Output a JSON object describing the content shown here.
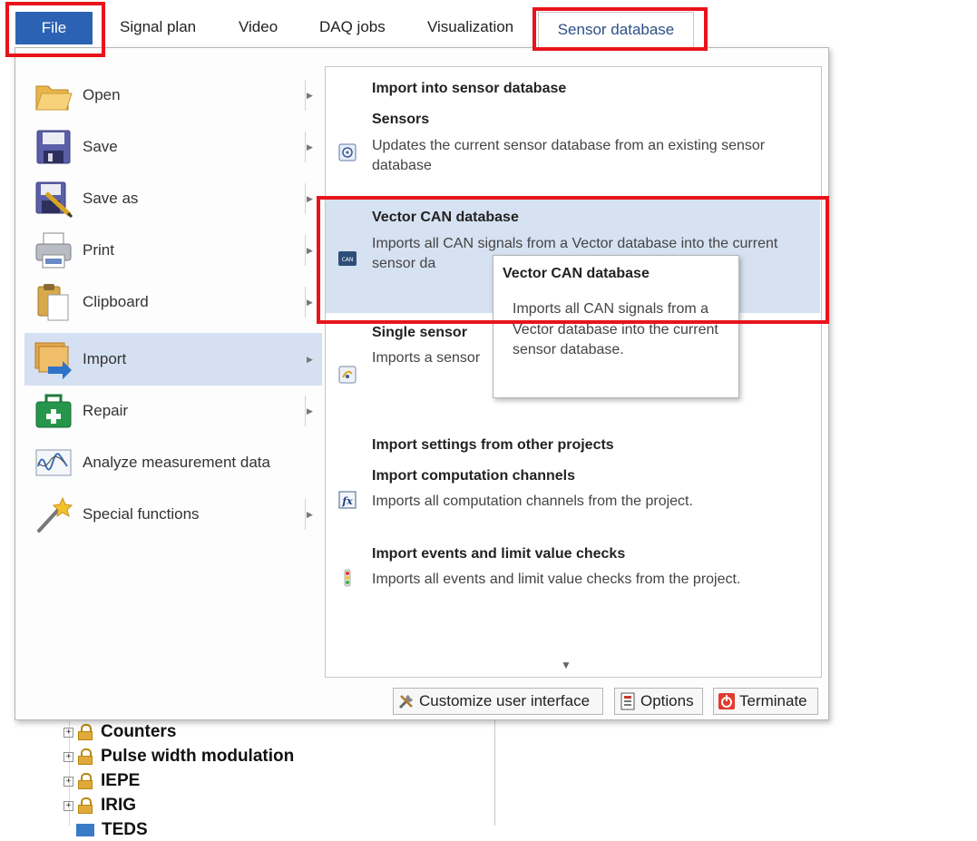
{
  "ribbon": {
    "file_tab": "File",
    "tabs": [
      {
        "label": "Signal plan"
      },
      {
        "label": "Video"
      },
      {
        "label": "DAQ jobs"
      },
      {
        "label": "Visualization"
      },
      {
        "label": "Sensor database"
      }
    ],
    "selected_tab": "Sensor database"
  },
  "file_menu": {
    "items": [
      {
        "label": "Open",
        "icon": "folder-open-icon",
        "submenu": true
      },
      {
        "label": "Save",
        "icon": "floppy-disk-icon",
        "submenu": true
      },
      {
        "label": "Save as",
        "icon": "save-as-icon",
        "submenu": true
      },
      {
        "label": "Print",
        "icon": "printer-icon",
        "submenu": true
      },
      {
        "label": "Clipboard",
        "icon": "clipboard-icon",
        "submenu": true
      },
      {
        "label": "Import",
        "icon": "import-icon",
        "submenu": true,
        "active": true
      },
      {
        "label": "Repair",
        "icon": "first-aid-kit-icon",
        "submenu": true
      },
      {
        "label": "Analyze measurement data",
        "icon": "waveform-icon",
        "submenu": false
      },
      {
        "label": "Special functions",
        "icon": "magic-wand-icon",
        "submenu": true
      }
    ]
  },
  "import_pane": {
    "section1_header": "Import into sensor database",
    "options": [
      {
        "title": "Sensors",
        "desc": "Updates the current sensor database from an existing sensor database",
        "icon": "sensor-db-icon"
      },
      {
        "title": "Vector CAN database",
        "desc": "Imports all CAN signals from a Vector database into the current sensor da",
        "icon": "can-icon",
        "highlighted": true
      },
      {
        "title": "Single sensor",
        "desc": "Imports a sensor",
        "icon": "single-sensor-icon"
      }
    ],
    "section2_header": "Import settings from other projects",
    "options2": [
      {
        "title": "Import computation channels",
        "desc": "Imports all computation channels from the project.",
        "icon": "fx-icon"
      },
      {
        "title": "Import events and limit value checks",
        "desc": "Imports all events and limit value checks from the project.",
        "icon": "traffic-light-icon"
      }
    ],
    "scroll_down": "▼"
  },
  "tooltip": {
    "title": "Vector CAN database",
    "body": "Imports all CAN signals from a Vector database into the current sensor database."
  },
  "bottom_buttons": {
    "customize": "Customize user interface",
    "options": "Options",
    "terminate": "Terminate"
  },
  "tree": {
    "items": [
      "Counters",
      "Pulse width modulation",
      "IEPE",
      "IRIG",
      "TEDS"
    ]
  },
  "colors": {
    "file_tab": "#2c62b3",
    "highlight_box": "#e8141b",
    "active_item_bg": "#d5e1f2",
    "hover_option_bg": "#d6e1f1"
  }
}
